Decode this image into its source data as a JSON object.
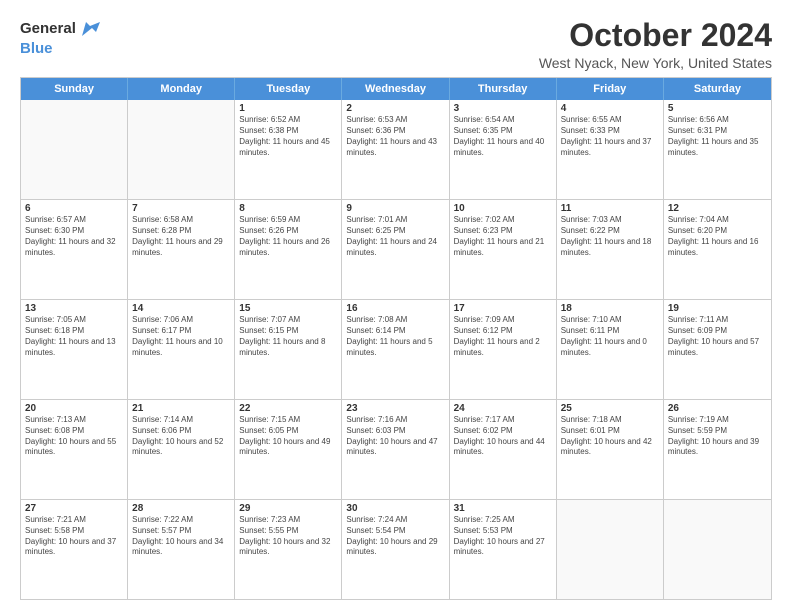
{
  "logo": {
    "line1": "General",
    "line2": "Blue",
    "arrow_color": "#4a90d9"
  },
  "header": {
    "month": "October 2024",
    "location": "West Nyack, New York, United States"
  },
  "days_of_week": [
    "Sunday",
    "Monday",
    "Tuesday",
    "Wednesday",
    "Thursday",
    "Friday",
    "Saturday"
  ],
  "weeks": [
    [
      {
        "day": "",
        "sunrise": "",
        "sunset": "",
        "daylight": ""
      },
      {
        "day": "",
        "sunrise": "",
        "sunset": "",
        "daylight": ""
      },
      {
        "day": "1",
        "sunrise": "Sunrise: 6:52 AM",
        "sunset": "Sunset: 6:38 PM",
        "daylight": "Daylight: 11 hours and 45 minutes."
      },
      {
        "day": "2",
        "sunrise": "Sunrise: 6:53 AM",
        "sunset": "Sunset: 6:36 PM",
        "daylight": "Daylight: 11 hours and 43 minutes."
      },
      {
        "day": "3",
        "sunrise": "Sunrise: 6:54 AM",
        "sunset": "Sunset: 6:35 PM",
        "daylight": "Daylight: 11 hours and 40 minutes."
      },
      {
        "day": "4",
        "sunrise": "Sunrise: 6:55 AM",
        "sunset": "Sunset: 6:33 PM",
        "daylight": "Daylight: 11 hours and 37 minutes."
      },
      {
        "day": "5",
        "sunrise": "Sunrise: 6:56 AM",
        "sunset": "Sunset: 6:31 PM",
        "daylight": "Daylight: 11 hours and 35 minutes."
      }
    ],
    [
      {
        "day": "6",
        "sunrise": "Sunrise: 6:57 AM",
        "sunset": "Sunset: 6:30 PM",
        "daylight": "Daylight: 11 hours and 32 minutes."
      },
      {
        "day": "7",
        "sunrise": "Sunrise: 6:58 AM",
        "sunset": "Sunset: 6:28 PM",
        "daylight": "Daylight: 11 hours and 29 minutes."
      },
      {
        "day": "8",
        "sunrise": "Sunrise: 6:59 AM",
        "sunset": "Sunset: 6:26 PM",
        "daylight": "Daylight: 11 hours and 26 minutes."
      },
      {
        "day": "9",
        "sunrise": "Sunrise: 7:01 AM",
        "sunset": "Sunset: 6:25 PM",
        "daylight": "Daylight: 11 hours and 24 minutes."
      },
      {
        "day": "10",
        "sunrise": "Sunrise: 7:02 AM",
        "sunset": "Sunset: 6:23 PM",
        "daylight": "Daylight: 11 hours and 21 minutes."
      },
      {
        "day": "11",
        "sunrise": "Sunrise: 7:03 AM",
        "sunset": "Sunset: 6:22 PM",
        "daylight": "Daylight: 11 hours and 18 minutes."
      },
      {
        "day": "12",
        "sunrise": "Sunrise: 7:04 AM",
        "sunset": "Sunset: 6:20 PM",
        "daylight": "Daylight: 11 hours and 16 minutes."
      }
    ],
    [
      {
        "day": "13",
        "sunrise": "Sunrise: 7:05 AM",
        "sunset": "Sunset: 6:18 PM",
        "daylight": "Daylight: 11 hours and 13 minutes."
      },
      {
        "day": "14",
        "sunrise": "Sunrise: 7:06 AM",
        "sunset": "Sunset: 6:17 PM",
        "daylight": "Daylight: 11 hours and 10 minutes."
      },
      {
        "day": "15",
        "sunrise": "Sunrise: 7:07 AM",
        "sunset": "Sunset: 6:15 PM",
        "daylight": "Daylight: 11 hours and 8 minutes."
      },
      {
        "day": "16",
        "sunrise": "Sunrise: 7:08 AM",
        "sunset": "Sunset: 6:14 PM",
        "daylight": "Daylight: 11 hours and 5 minutes."
      },
      {
        "day": "17",
        "sunrise": "Sunrise: 7:09 AM",
        "sunset": "Sunset: 6:12 PM",
        "daylight": "Daylight: 11 hours and 2 minutes."
      },
      {
        "day": "18",
        "sunrise": "Sunrise: 7:10 AM",
        "sunset": "Sunset: 6:11 PM",
        "daylight": "Daylight: 11 hours and 0 minutes."
      },
      {
        "day": "19",
        "sunrise": "Sunrise: 7:11 AM",
        "sunset": "Sunset: 6:09 PM",
        "daylight": "Daylight: 10 hours and 57 minutes."
      }
    ],
    [
      {
        "day": "20",
        "sunrise": "Sunrise: 7:13 AM",
        "sunset": "Sunset: 6:08 PM",
        "daylight": "Daylight: 10 hours and 55 minutes."
      },
      {
        "day": "21",
        "sunrise": "Sunrise: 7:14 AM",
        "sunset": "Sunset: 6:06 PM",
        "daylight": "Daylight: 10 hours and 52 minutes."
      },
      {
        "day": "22",
        "sunrise": "Sunrise: 7:15 AM",
        "sunset": "Sunset: 6:05 PM",
        "daylight": "Daylight: 10 hours and 49 minutes."
      },
      {
        "day": "23",
        "sunrise": "Sunrise: 7:16 AM",
        "sunset": "Sunset: 6:03 PM",
        "daylight": "Daylight: 10 hours and 47 minutes."
      },
      {
        "day": "24",
        "sunrise": "Sunrise: 7:17 AM",
        "sunset": "Sunset: 6:02 PM",
        "daylight": "Daylight: 10 hours and 44 minutes."
      },
      {
        "day": "25",
        "sunrise": "Sunrise: 7:18 AM",
        "sunset": "Sunset: 6:01 PM",
        "daylight": "Daylight: 10 hours and 42 minutes."
      },
      {
        "day": "26",
        "sunrise": "Sunrise: 7:19 AM",
        "sunset": "Sunset: 5:59 PM",
        "daylight": "Daylight: 10 hours and 39 minutes."
      }
    ],
    [
      {
        "day": "27",
        "sunrise": "Sunrise: 7:21 AM",
        "sunset": "Sunset: 5:58 PM",
        "daylight": "Daylight: 10 hours and 37 minutes."
      },
      {
        "day": "28",
        "sunrise": "Sunrise: 7:22 AM",
        "sunset": "Sunset: 5:57 PM",
        "daylight": "Daylight: 10 hours and 34 minutes."
      },
      {
        "day": "29",
        "sunrise": "Sunrise: 7:23 AM",
        "sunset": "Sunset: 5:55 PM",
        "daylight": "Daylight: 10 hours and 32 minutes."
      },
      {
        "day": "30",
        "sunrise": "Sunrise: 7:24 AM",
        "sunset": "Sunset: 5:54 PM",
        "daylight": "Daylight: 10 hours and 29 minutes."
      },
      {
        "day": "31",
        "sunrise": "Sunrise: 7:25 AM",
        "sunset": "Sunset: 5:53 PM",
        "daylight": "Daylight: 10 hours and 27 minutes."
      },
      {
        "day": "",
        "sunrise": "",
        "sunset": "",
        "daylight": ""
      },
      {
        "day": "",
        "sunrise": "",
        "sunset": "",
        "daylight": ""
      }
    ]
  ]
}
